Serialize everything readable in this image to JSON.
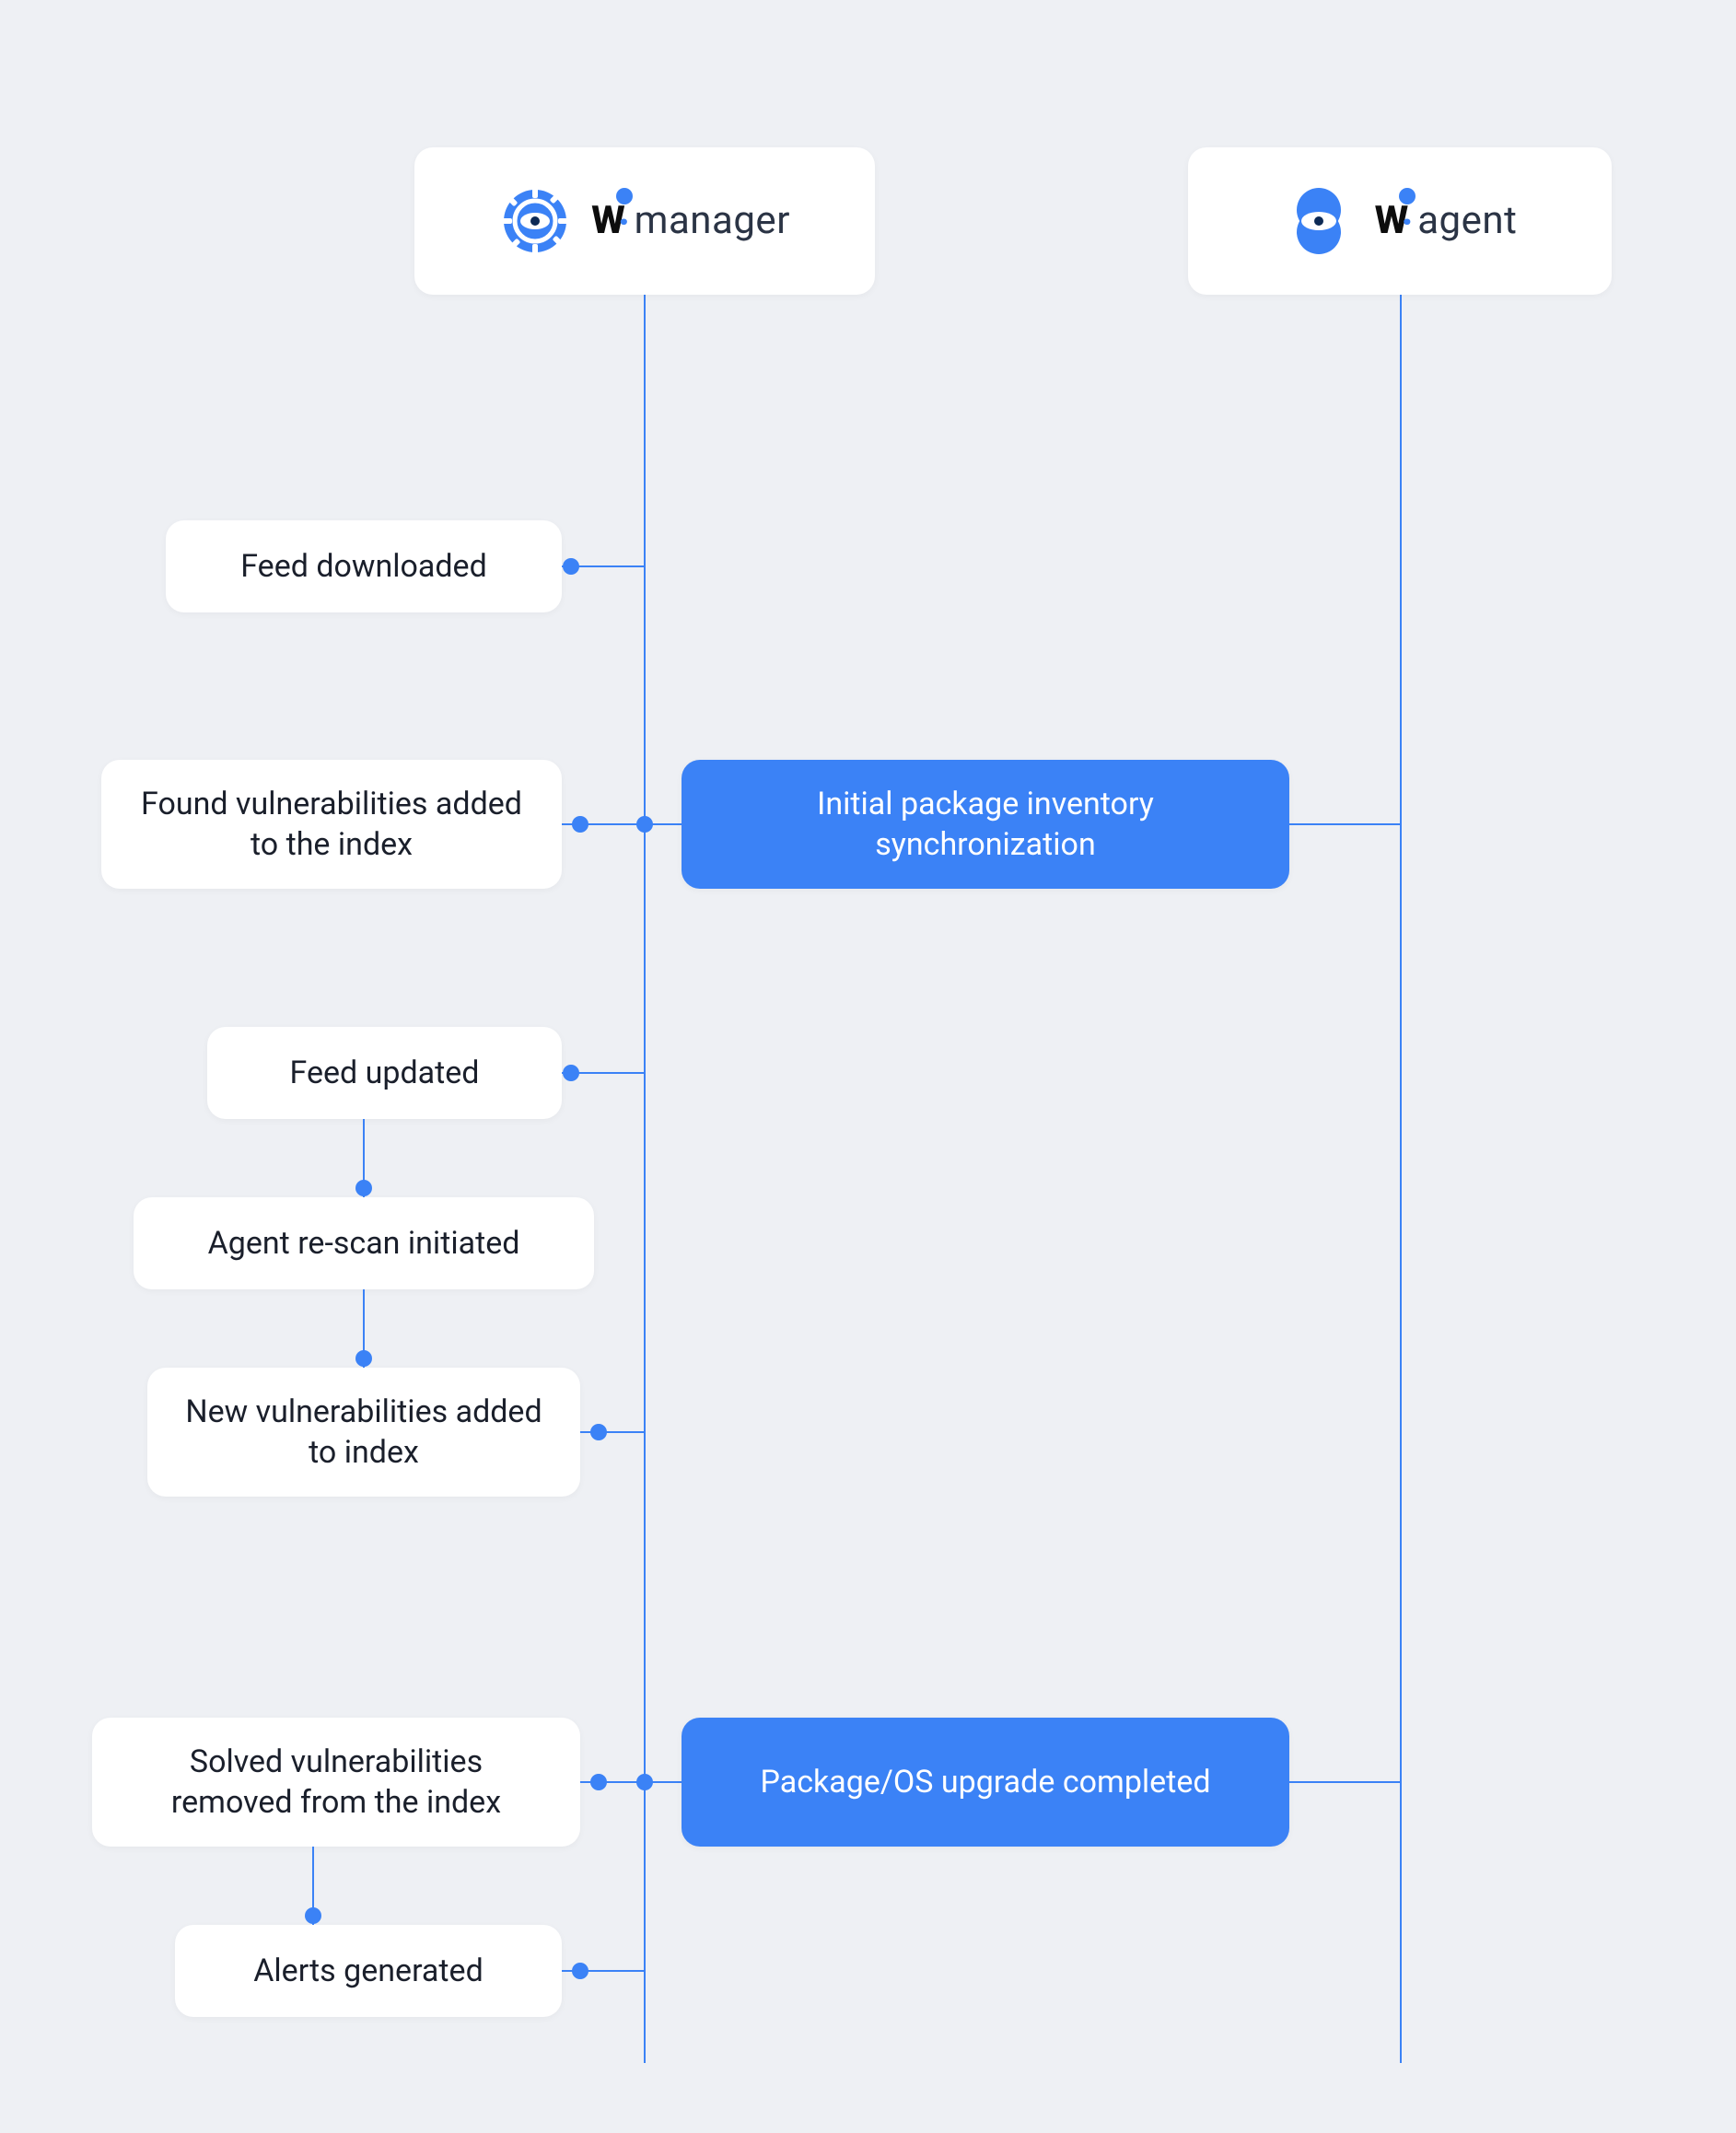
{
  "colors": {
    "accent": "#3b82f6",
    "background": "#eef0f4",
    "card": "#ffffff",
    "text": "#1a1f2b"
  },
  "lanes": {
    "manager": {
      "title_prefix": "W",
      "title_suffix": "manager",
      "icon": "gear-eye-icon"
    },
    "agent": {
      "title_prefix": "W",
      "title_suffix": "agent",
      "icon": "overlap-circles-icon"
    }
  },
  "events": {
    "feed_downloaded": "Feed downloaded",
    "found_vuln_indexed": "Found vulnerabilities added to the index",
    "initial_sync": "Initial package inventory synchronization",
    "feed_updated": "Feed updated",
    "agent_rescan": "Agent re-scan initiated",
    "new_vuln_indexed": "New vulnerabilities added to index",
    "solved_removed": "Solved vulnerabilities removed from the index",
    "pkg_upgrade": "Package/OS upgrade completed",
    "alerts_generated": "Alerts generated"
  }
}
